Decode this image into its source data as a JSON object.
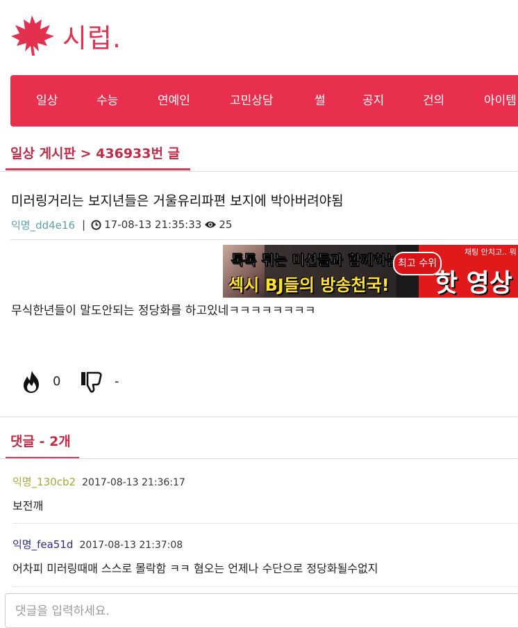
{
  "brand": {
    "name": "시럽.",
    "accent": "#e8304e",
    "title_red": "#c22a45"
  },
  "nav": {
    "items": [
      "일상",
      "수능",
      "연예인",
      "고민상담",
      "썰",
      "공지",
      "건의",
      "아이템"
    ]
  },
  "breadcrumb": "일상 게시판 > 436933번 글",
  "post": {
    "title": "미러링거리는 보지년들은 거울유리파편 보지에 박아버려야됨",
    "author": "익명_dd4e16",
    "datetime": "17-08-13 21:35:33",
    "views": "25",
    "body": "무식한년들이 말도안되는 정당화를 하고있네ㅋㅋㅋㅋㅋㅋㅋㅋ",
    "likes": "0",
    "dislikes": "-"
  },
  "ad": {
    "line1": "톡톡 튀는 미션들과 함께하는",
    "line2": "섹시 BJ들의 방송천국!",
    "badge": "최고 수위",
    "tag": "채팅 안치고.. 뭐",
    "headline": "핫 영상"
  },
  "comments": {
    "title": "댓글 - 2개",
    "items": [
      {
        "author": "익명_130cb2",
        "author_color": "#a9a93a",
        "date": "2017-08-13 21:36:17",
        "text": "보전깨"
      },
      {
        "author": "익명_fea51d",
        "author_color": "#2a2a8a",
        "date": "2017-08-13 21:37:08",
        "text": "어차피 미러링때매 스스로 몰락함 ㅋㅋ 혐오는 언제나 수단으로 정당화될수없지"
      }
    ],
    "input_placeholder": "댓글을 입력하세요."
  },
  "icons": {
    "logo": "maple-leaf-icon",
    "time": "clock-icon",
    "views": "eye-icon",
    "like": "flame-icon",
    "dislike": "thumbs-down-icon"
  }
}
